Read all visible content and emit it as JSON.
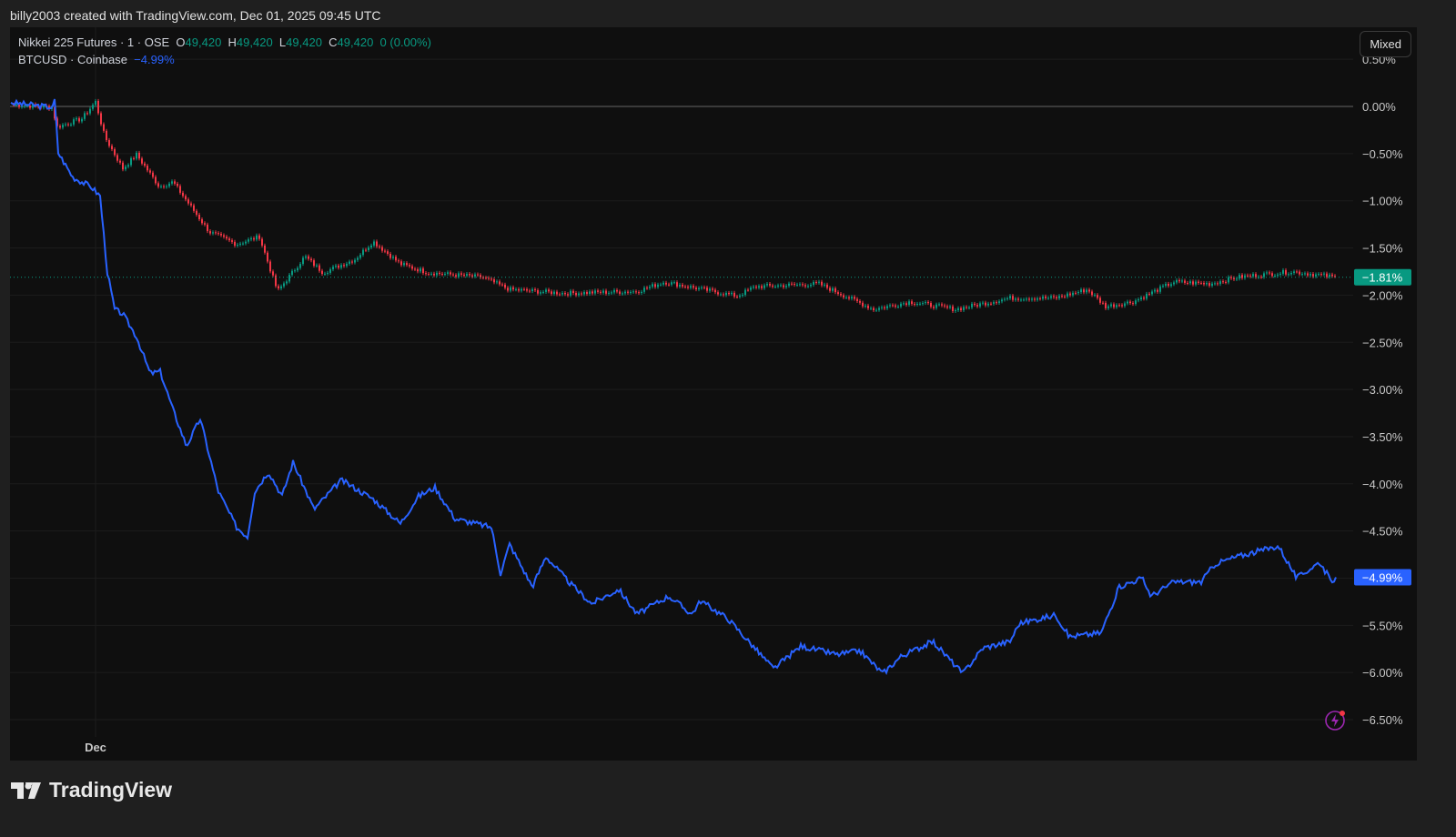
{
  "credit": "billy2003 created with TradingView.com, Dec 01, 2025 09:45 UTC",
  "legend": {
    "nikkei": {
      "title": "Nikkei 225 Futures · 1 · OSE",
      "o_label": "O",
      "o": "49,420",
      "h_label": "H",
      "h": "49,420",
      "l_label": "L",
      "l": "49,420",
      "c_label": "C",
      "c": "49,420",
      "change": "0 (0.00%)"
    },
    "btc": {
      "title": "BTCUSD · Coinbase",
      "change": "−4.99%"
    }
  },
  "mixed_button": "Mixed",
  "brand": "TradingView",
  "colors": {
    "btc": "#2962ff",
    "up": "#089981",
    "down": "#f23645",
    "bg": "#0f0f0f"
  },
  "chart_data": {
    "type": "line",
    "title": "Nikkei 225 Futures vs BTCUSD (% change)",
    "xlabel": "",
    "ylabel": "%",
    "ylim": [
      -6.8,
      0.6
    ],
    "xlim": [
      0,
      1475
    ],
    "x_ticks": [
      {
        "t": 93,
        "label": "Dec"
      }
    ],
    "y_ticks": [
      {
        "v": 0.5,
        "label": "0.50%"
      },
      {
        "v": 0,
        "label": "0.00%"
      },
      {
        "v": -0.5,
        "label": "−0.50%"
      },
      {
        "v": -1,
        "label": "−1.00%"
      },
      {
        "v": -1.5,
        "label": "−1.50%"
      },
      {
        "v": -2,
        "label": "−2.00%"
      },
      {
        "v": -2.5,
        "label": "−2.50%"
      },
      {
        "v": -3,
        "label": "−3.00%"
      },
      {
        "v": -3.5,
        "label": "−3.50%"
      },
      {
        "v": -4,
        "label": "−4.00%"
      },
      {
        "v": -4.5,
        "label": "−4.50%"
      },
      {
        "v": -5,
        "label": "−5.00%"
      },
      {
        "v": -5.5,
        "label": "−5.50%"
      },
      {
        "v": -6,
        "label": "−6.00%"
      },
      {
        "v": -6.5,
        "label": "−6.50%"
      }
    ],
    "grid": true,
    "series": [
      {
        "name": "Nikkei 225 Futures",
        "style": "candles",
        "last_label": "−1.81%",
        "last": -1.81,
        "t": [
          0,
          46,
          50,
          78,
          93,
          103,
          123,
          138,
          163,
          178,
          218,
          248,
          273,
          293,
          323,
          343,
          378,
          398,
          428,
          458,
          518,
          548,
          608,
          688,
          718,
          798,
          818,
          888,
          948,
          988,
          1038,
          1098,
          1148,
          1183,
          1203,
          1233,
          1278,
          1318,
          1348,
          1408,
          1456
        ],
        "values": [
          0.02,
          -0.01,
          -0.22,
          -0.13,
          0.05,
          -0.32,
          -0.66,
          -0.51,
          -0.85,
          -0.8,
          -1.33,
          -1.46,
          -1.38,
          -1.96,
          -1.59,
          -1.76,
          -1.62,
          -1.43,
          -1.67,
          -1.76,
          -1.81,
          -1.94,
          -1.98,
          -1.96,
          -1.86,
          -2.01,
          -1.91,
          -1.88,
          -2.15,
          -2.07,
          -2.15,
          -2.03,
          -2.03,
          -1.94,
          -2.12,
          -2.07,
          -1.86,
          -1.88,
          -1.81,
          -1.75,
          -1.81
        ]
      },
      {
        "name": "BTCUSD",
        "style": "line",
        "last_label": "−4.99%",
        "last": -4.99,
        "t": [
          0,
          46,
          48,
          52,
          68,
          88,
          98,
          106,
          114,
          123,
          138,
          153,
          164,
          178,
          193,
          208,
          228,
          248,
          260,
          268,
          283,
          298,
          310,
          333,
          363,
          398,
          428,
          448,
          466,
          488,
          528,
          538,
          548,
          573,
          588,
          613,
          638,
          668,
          688,
          723,
          748,
          758,
          788,
          838,
          868,
          908,
          933,
          958,
          978,
          1013,
          1046,
          1068,
          1098,
          1108,
          1148,
          1163,
          1198,
          1218,
          1243,
          1253,
          1278,
          1308,
          1323,
          1348,
          1393,
          1413,
          1438,
          1453,
          1456
        ],
        "values": [
          0.04,
          -0.01,
          0.07,
          -0.49,
          -0.75,
          -0.85,
          -0.95,
          -1.76,
          -2.15,
          -2.2,
          -2.44,
          -2.83,
          -2.81,
          -3.21,
          -3.6,
          -3.31,
          -4.08,
          -4.46,
          -4.56,
          -4.08,
          -3.87,
          -4.13,
          -3.77,
          -4.27,
          -3.96,
          -4.16,
          -4.42,
          -4.13,
          -4.04,
          -4.37,
          -4.46,
          -4.95,
          -4.64,
          -5.09,
          -4.77,
          -5.04,
          -5.27,
          -5.12,
          -5.38,
          -5.19,
          -5.38,
          -5.24,
          -5.43,
          -5.96,
          -5.72,
          -5.81,
          -5.77,
          -6.01,
          -5.83,
          -5.67,
          -6.01,
          -5.74,
          -5.67,
          -5.48,
          -5.39,
          -5.62,
          -5.58,
          -5.09,
          -5.0,
          -5.19,
          -5.04,
          -5.04,
          -4.85,
          -4.77,
          -4.66,
          -5.0,
          -4.83,
          -5.06,
          -4.99
        ]
      }
    ]
  }
}
